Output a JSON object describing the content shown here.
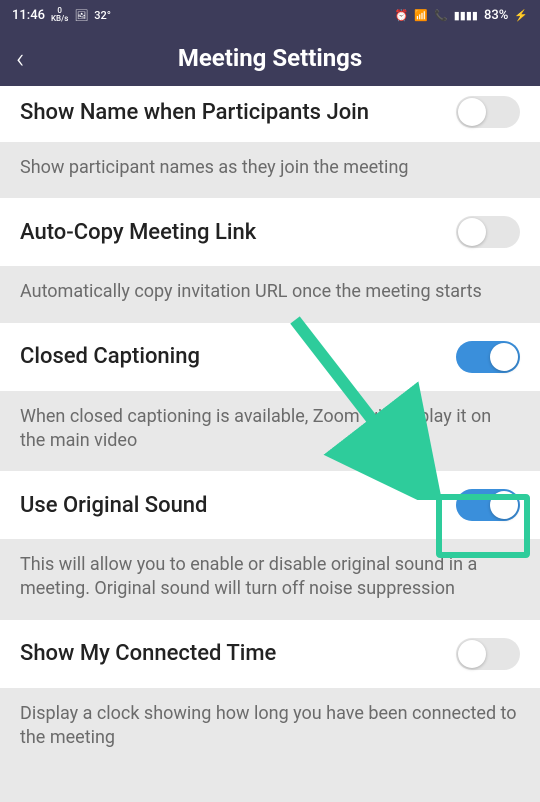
{
  "status": {
    "time": "11:46",
    "kbps_top": "0",
    "kbps_bottom": "KB/s",
    "picture_icon": "🖼",
    "temp": "32°",
    "alarm_icon": "⏰",
    "wifi_icon": "📶",
    "voip_icon": "📞",
    "signal_icon": "▮▮▮▮",
    "battery_pct": "83%",
    "battery_icon": "⚡"
  },
  "header": {
    "back": "‹",
    "title": "Meeting Settings"
  },
  "settings": [
    {
      "title": "Show Name when Participants Join",
      "desc": "Show participant names as they join the meeting",
      "enabled": false
    },
    {
      "title": "Auto-Copy Meeting Link",
      "desc": "Automatically copy invitation URL once the meeting starts",
      "enabled": false
    },
    {
      "title": "Closed Captioning",
      "desc": "When closed captioning is available, Zoom will display it on the main video",
      "enabled": true
    },
    {
      "title": "Use Original Sound",
      "desc": "This will allow you to enable or disable original sound in a meeting. Original sound will turn off noise suppression",
      "enabled": true
    },
    {
      "title": "Show My Connected Time",
      "desc": "Display a clock showing how long you have been connected to the meeting",
      "enabled": false
    }
  ],
  "annotation": {
    "highlight_index": 3,
    "arrow_color": "#2ecc9b"
  }
}
